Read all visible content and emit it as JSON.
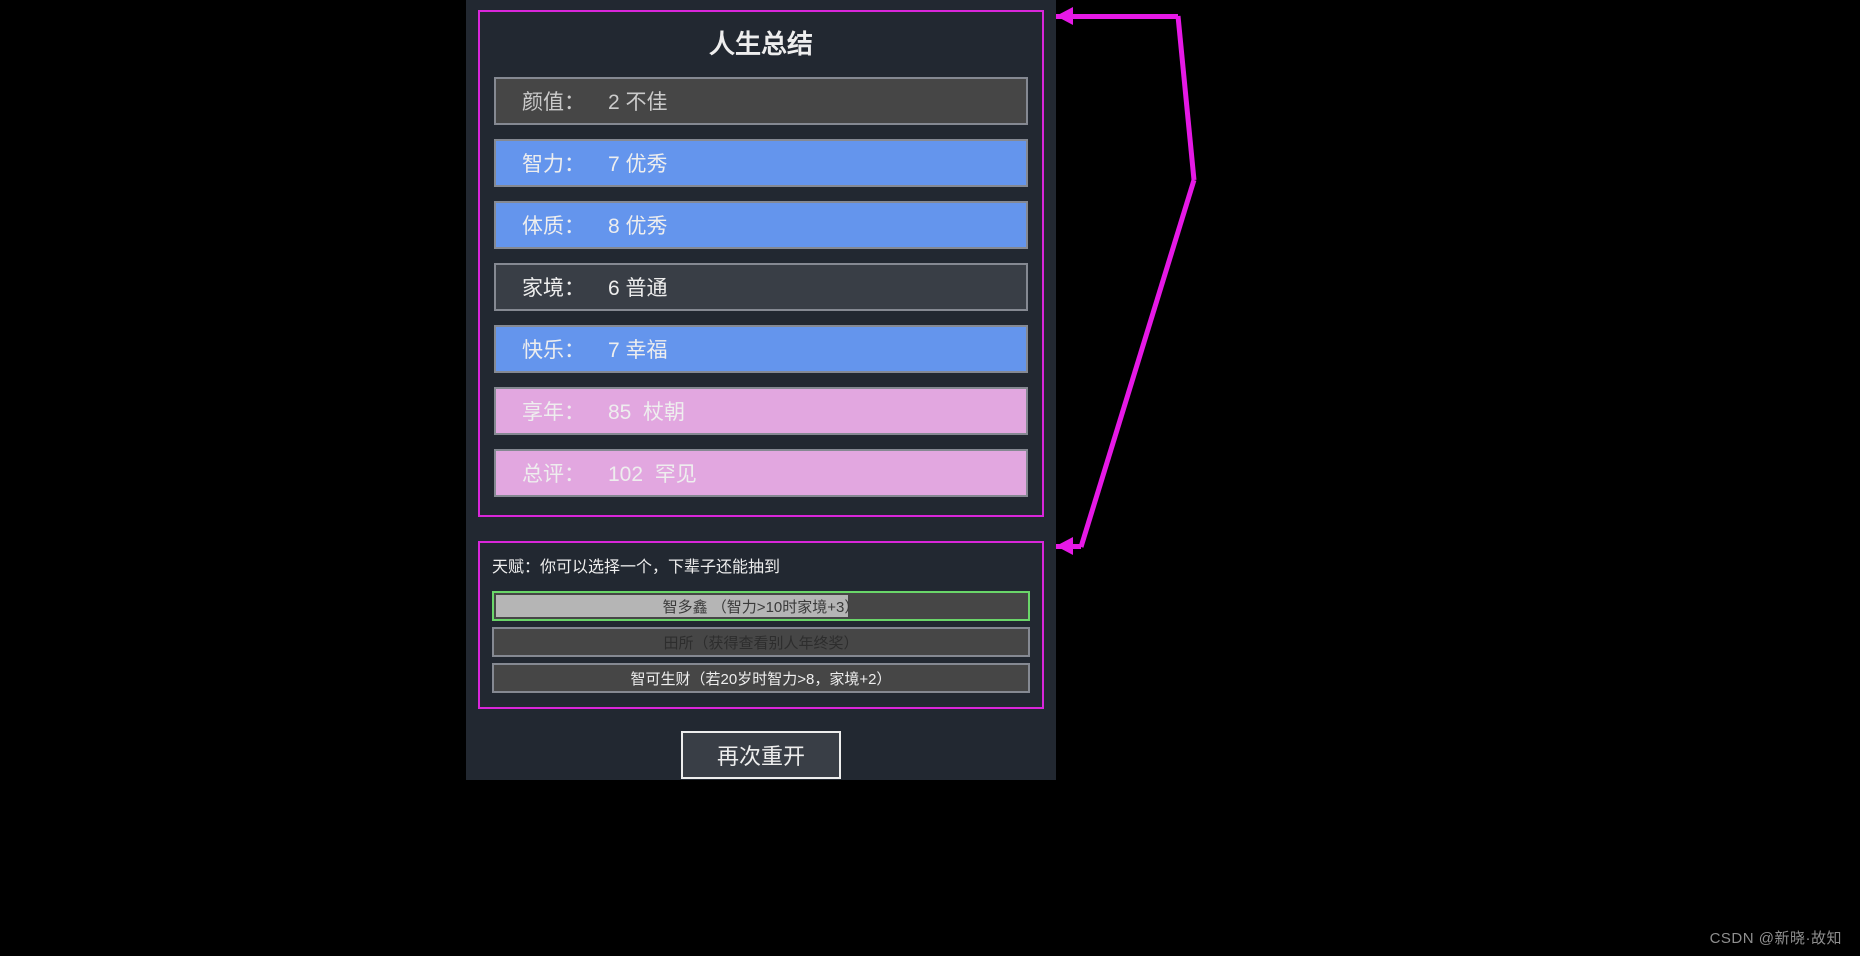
{
  "summary": {
    "title": "人生总结",
    "stats": [
      {
        "label": "颜值：",
        "value": "2 不佳",
        "tier": "gray"
      },
      {
        "label": "智力：",
        "value": "7 优秀",
        "tier": "blue"
      },
      {
        "label": "体质：",
        "value": "8 优秀",
        "tier": "blue"
      },
      {
        "label": "家境：",
        "value": "6 普通",
        "tier": "dark"
      },
      {
        "label": "快乐：",
        "value": "7 幸福",
        "tier": "blue"
      },
      {
        "label": "享年：",
        "value": "85  杖朝",
        "tier": "pink"
      },
      {
        "label": "总评：",
        "value": "102  罕见",
        "tier": "pink"
      }
    ]
  },
  "talent": {
    "hint": "天赋：你可以选择一个，下辈子还能抽到",
    "items": [
      {
        "label": "智多鑫 （智力>10时家境+3）",
        "state": "selected"
      },
      {
        "label": "田所（获得查看别人年终奖）",
        "state": "dim"
      },
      {
        "label": "智可生财（若20岁时智力>8，家境+2）",
        "state": "normal"
      }
    ]
  },
  "restart_label": "再次重开",
  "watermark": "CSDN @新晓·故知"
}
